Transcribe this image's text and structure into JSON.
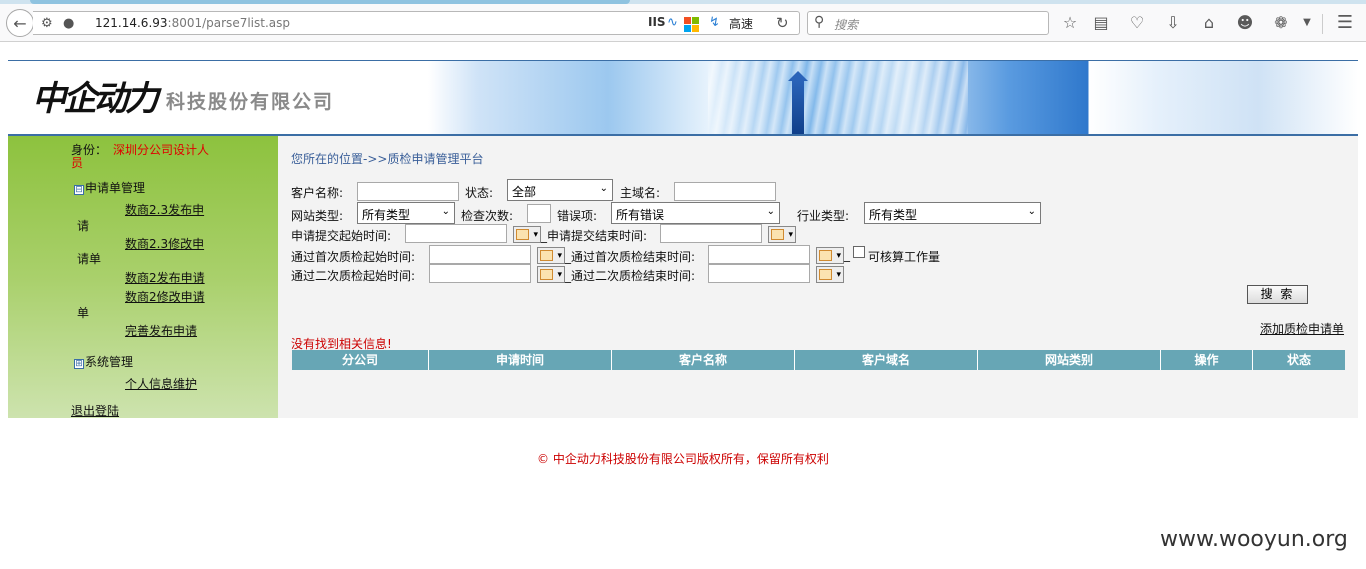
{
  "browser": {
    "url_host": "121.14.6.93",
    "url_rest": ":8001/parse7list.asp",
    "iis_label": "IIS",
    "speed_label": "高速",
    "search_placeholder": "搜索"
  },
  "banner": {
    "logo_text": "中企动力",
    "company_suffix": "科技股份有限公司"
  },
  "sidebar": {
    "identity_label": "身份：",
    "identity_value_line1": "深圳分公司设计人",
    "identity_value_line2": "员",
    "group_apply": {
      "toggle": "⊟",
      "label": "申请单管理"
    },
    "apply_items": [
      {
        "line1": "数商2.3发布申",
        "line2": "请"
      },
      {
        "line1": "数商2.3修改申",
        "line2": "请单"
      },
      {
        "line1": "数商2发布申请"
      },
      {
        "line1": "数商2修改申请",
        "line2": "单"
      },
      {
        "line1": "完善发布申请"
      }
    ],
    "group_system": {
      "toggle": "⊞",
      "label": "系统管理"
    },
    "system_items": [
      {
        "line1": "个人信息维护"
      }
    ],
    "logout": "退出登陆"
  },
  "main": {
    "breadcrumb": "您所在的位置->>质检申请管理平台",
    "form": {
      "customer_name_label": "客户名称:",
      "status_label": "状态:",
      "status_value": "全部",
      "domain_label": "主域名:",
      "site_type_label": "网站类型:",
      "site_type_value": "所有类型",
      "check_count_label": "检查次数:",
      "error_label": "错误项:",
      "error_value": "所有错误",
      "industry_label": "行业类型:",
      "industry_value": "所有类型",
      "submit_start_label": "申请提交起始时间:",
      "submit_end_label": "申请提交结束时间:",
      "first_start_label": "通过首次质检起始时间:",
      "first_end_label": "通过首次质检结束时间:",
      "accountable_label": "可核算工作量",
      "second_start_label": "通过二次质检起始时间:",
      "second_end_label": "通过二次质检结束时间:"
    },
    "search_button": "搜 索",
    "add_link": "添加质检申请单",
    "no_result": "没有找到相关信息!",
    "table_columns": [
      "分公司",
      "申请时间",
      "客户名称",
      "客户域名",
      "网站类别",
      "操作",
      "状态"
    ]
  },
  "footer": "© 中企动力科技股份有限公司版权所有，保留所有权利",
  "watermark": "www.wooyun.org",
  "colors": {
    "table_header": "#67a6b5",
    "sidebar_green": "#8dc23e",
    "alert_red": "#cc0000",
    "banner_line": "#3b6ea5"
  }
}
